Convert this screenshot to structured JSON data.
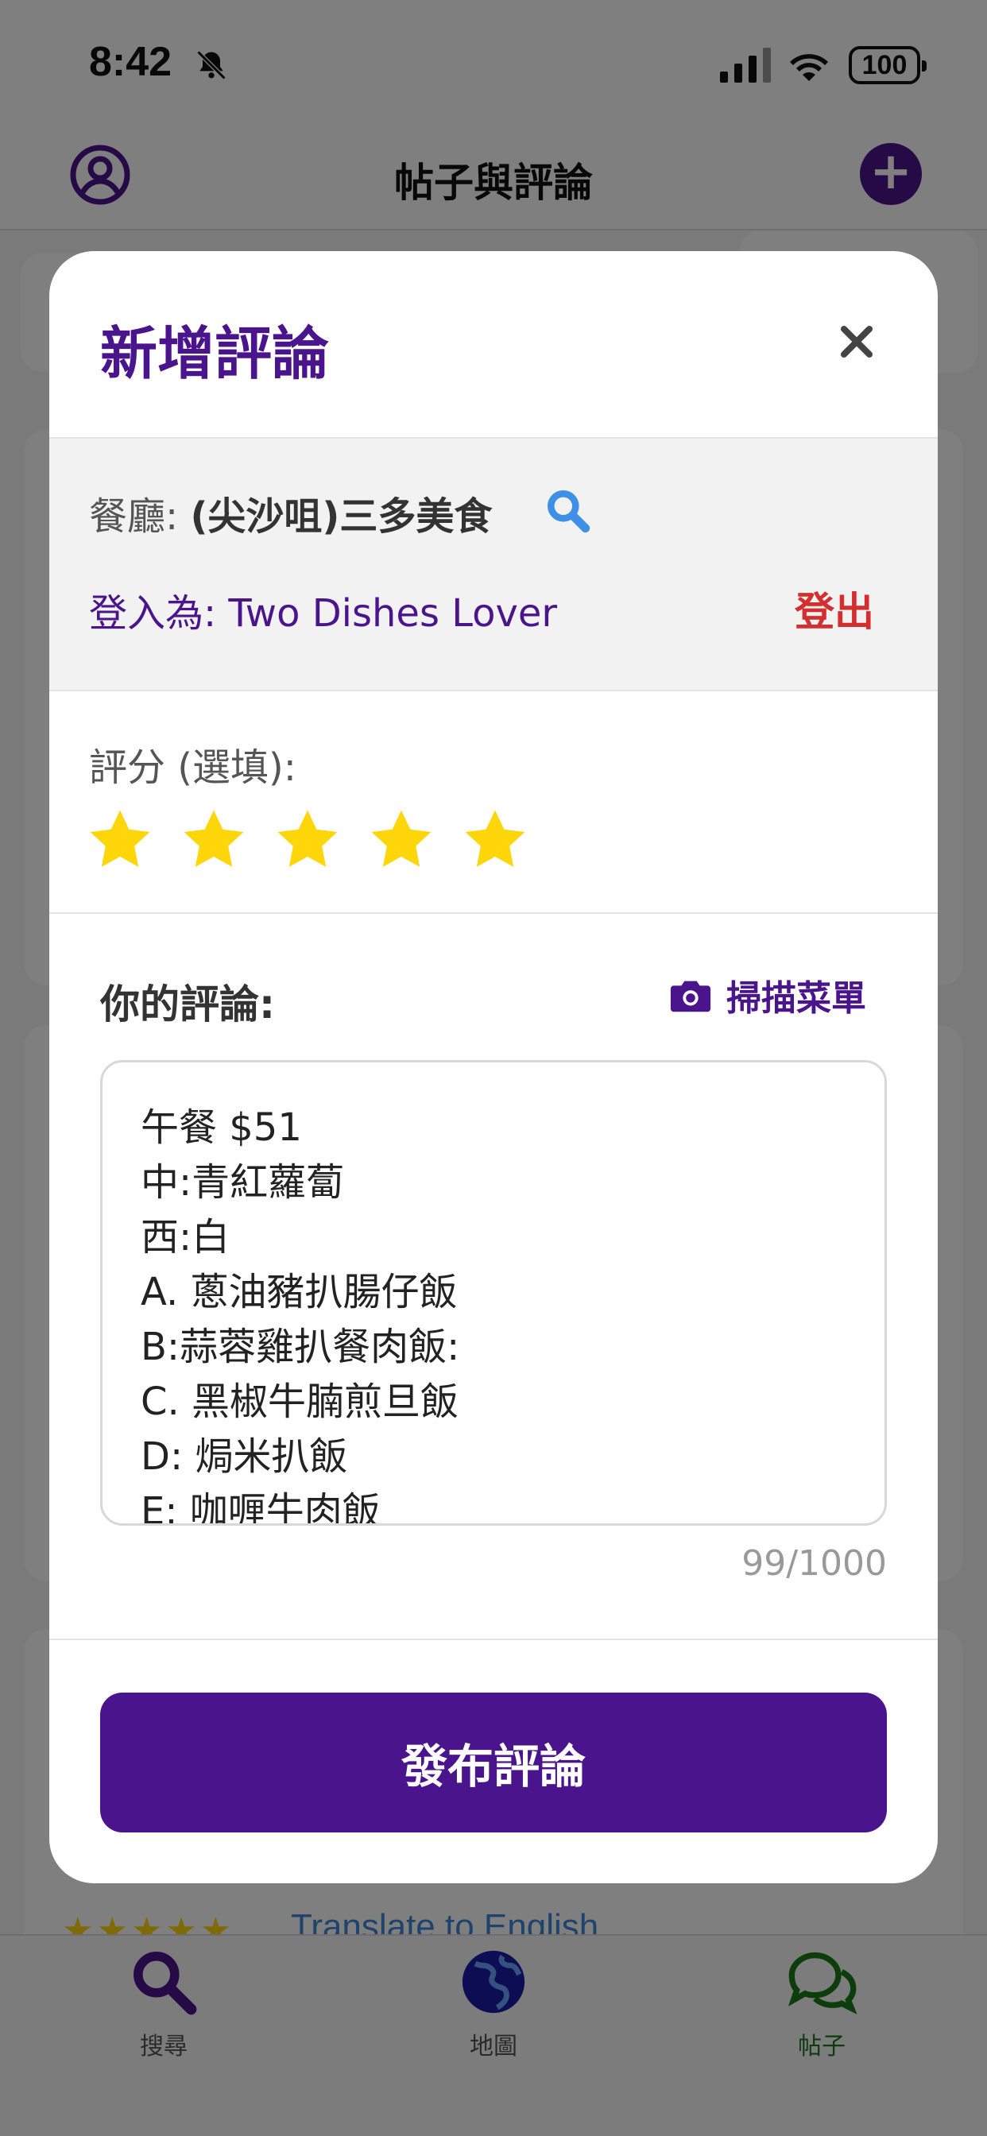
{
  "status_bar": {
    "time": "8:42",
    "battery": "100"
  },
  "app_bar": {
    "title": "帖子與評論"
  },
  "background": {
    "stars": "★★★★★",
    "translate_link": "Translate to English"
  },
  "tab_bar": {
    "items": [
      {
        "label": "搜尋",
        "icon": "search-icon",
        "color": "#4a148c"
      },
      {
        "label": "地圖",
        "icon": "globe-icon",
        "color": "#1a1aa6"
      },
      {
        "label": "帖子",
        "icon": "chat-bubbles-icon",
        "color": "#1b7a1b"
      }
    ]
  },
  "modal": {
    "title": "新增評論",
    "restaurant_prefix": "餐廳:",
    "restaurant_name": "(尖沙咀)三多美食",
    "login_text": "登入為: Two Dishes Lover",
    "logout_label": "登出",
    "rating_label": "評分 (選填):",
    "rating_value": 5,
    "rating_max": 5,
    "comment_label": "你的評論:",
    "scan_menu_label": "掃描菜單",
    "comment_lines": [
      "午餐 $51",
      "中:青紅蘿蔔",
      "西:白",
      "A. 蔥油豬扒腸仔飯",
      "B:蒜蓉雞扒餐肉飯:",
      "C. 黑椒牛腩煎旦飯",
      "D: 焗米扒飯",
      "E: 咖喱牛肉飯"
    ],
    "char_count": "99/1000",
    "submit_label": "發布評論"
  },
  "colors": {
    "brand_purple": "#4a148c",
    "logout_red": "#d32f2f",
    "star_yellow": "#ffd60a",
    "search_blue": "#3f8fe6"
  }
}
